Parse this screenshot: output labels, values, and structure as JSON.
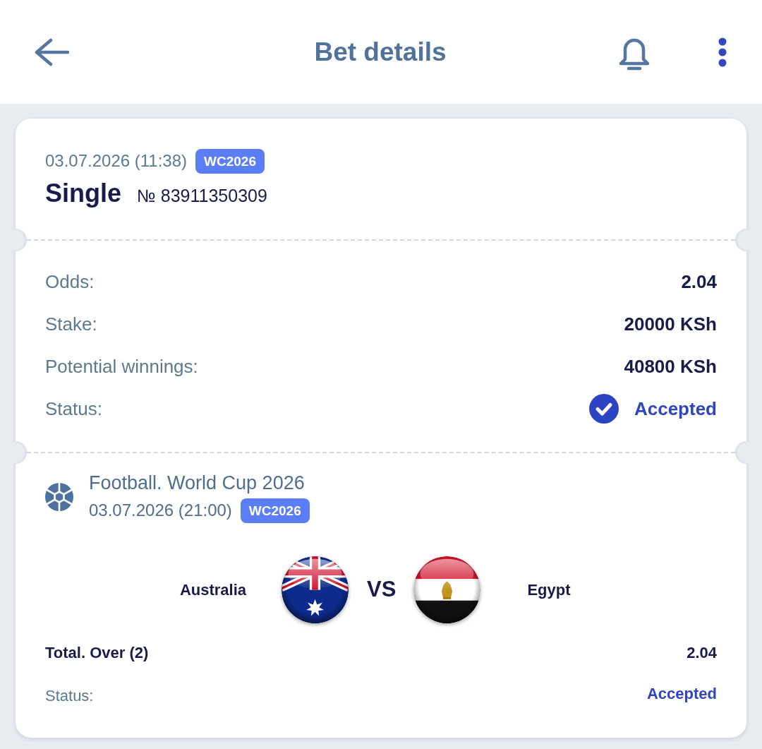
{
  "header": {
    "title": "Bet details"
  },
  "bet": {
    "date": "03.07.2026 (11:38)",
    "tag": "WC2026",
    "type": "Single",
    "number": "№ 83911350309"
  },
  "summary": [
    {
      "kind": "value",
      "label": "Odds:",
      "value": "2.04"
    },
    {
      "kind": "value",
      "label": "Stake:",
      "value": "20000 KSh"
    },
    {
      "kind": "value",
      "label": "Potential winnings:",
      "value": "40800 KSh"
    },
    {
      "kind": "status",
      "label": "Status:",
      "value": "Accepted"
    }
  ],
  "event": {
    "title": "Football. World Cup 2026",
    "date": "03.07.2026 (21:00)",
    "tag": "WC2026",
    "home_team": "Australia",
    "versus": "VS",
    "away_team": "Egypt"
  },
  "selection": {
    "market": "Total. Over (2)",
    "odds": "2.04",
    "status_label": "Status:",
    "status": "Accepted"
  }
}
